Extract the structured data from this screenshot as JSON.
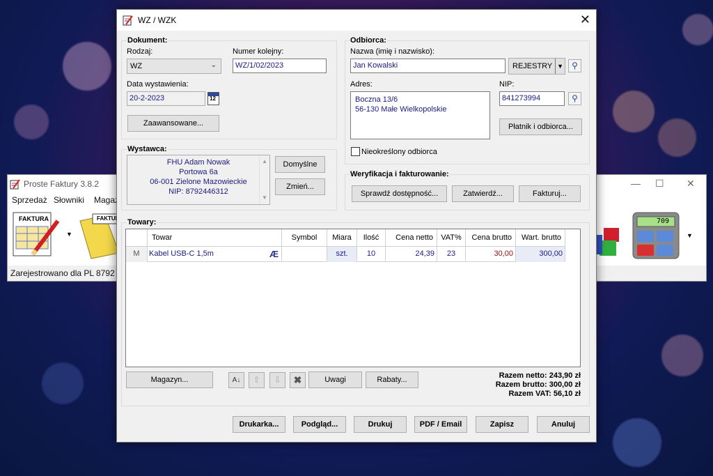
{
  "bg_window": {
    "title": "Proste Faktury 3.8.2",
    "menu": [
      "Sprzedaż",
      "Słowniki",
      "Magaz"
    ],
    "status": "Zarejestrowano dla PL 8792",
    "faktura_label": "FAKTURA",
    "calc_display": "709"
  },
  "dialog": {
    "title": "WZ / WZK",
    "dokument": {
      "group_label": "Dokument:",
      "rodzaj_label": "Rodzaj:",
      "rodzaj_value": "WZ",
      "numer_label": "Numer kolejny:",
      "numer_value": "WZ/1/02/2023",
      "data_label": "Data wystawienia:",
      "data_value": "20-2-2023",
      "calendar_day": "12",
      "advanced_button": "Zaawansowane..."
    },
    "odbiorca": {
      "group_label": "Odbiorca:",
      "nazwa_label": "Nazwa (imię i nazwisko):",
      "nazwa_value": "Jan Kowalski",
      "rejestry_button": "REJESTRY",
      "adres_label": "Adres:",
      "adres_line1": "Boczna 13/6",
      "adres_line2": "56-130 Małe Wielkopolskie",
      "nip_label": "NIP:",
      "nip_value": "841273994",
      "platnik_button": "Płatnik i odbiorca...",
      "nieokreslony_label": "Nieokreślony odbiorca"
    },
    "wystawca": {
      "group_label": "Wystawca:",
      "line1": "FHU Adam Nowak",
      "line2": "Portowa 6a",
      "line3": "06-001 Zielone Mazowieckie",
      "line4": "NIP: 8792446312",
      "domyslne_button": "Domyślne",
      "zmien_button": "Zmień..."
    },
    "weryfikacja": {
      "group_label": "Weryfikacja i fakturowanie:",
      "sprawdz_button": "Sprawdź dostępność...",
      "zatwierdz_button": "Zatwierdź...",
      "fakturuj_button": "Fakturuj..."
    },
    "towary": {
      "group_label": "Towary:",
      "columns": [
        "Towar",
        "Symbol",
        "Miara",
        "Ilość",
        "Cena netto",
        "VAT%",
        "Cena brutto",
        "Wart. brutto"
      ],
      "rows": [
        {
          "marker": "M",
          "towar": "Kabel USB-C 1,5m",
          "symbol_glyph": "Æ",
          "symbol": "",
          "miara": "szt.",
          "ilosc": "10",
          "cena_netto": "24,39",
          "vat": "23",
          "cena_brutto": "30,00",
          "wart_brutto": "300,00"
        }
      ],
      "magazyn_button": "Magazyn...",
      "uwagi_button": "Uwagi",
      "rabaty_button": "Rabaty...",
      "razem_netto": "Razem netto: 243,90 zł",
      "razem_brutto": "Razem brutto: 300,00 zł",
      "razem_vat": "Razem VAT: 56,10 zł"
    },
    "footer": {
      "drukarka": "Drukarka...",
      "podglad": "Podgląd...",
      "drukuj": "Drukuj",
      "pdf_email": "PDF / Email",
      "zapisz": "Zapisz",
      "anuluj": "Anuluj"
    }
  },
  "colors": {
    "value_text": "#1a1a80",
    "brutto_text": "#8a1010",
    "dialog_bg": "#f0f0f0"
  }
}
